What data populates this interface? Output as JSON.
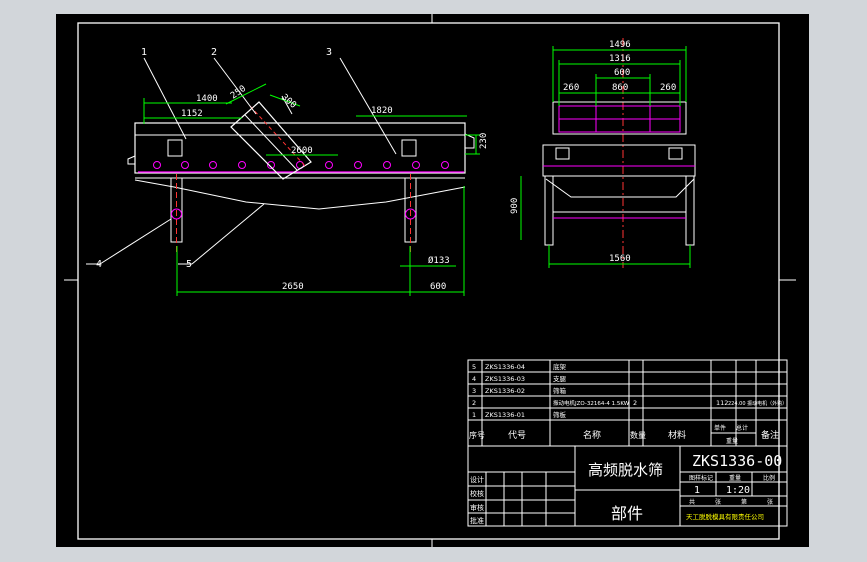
{
  "colors": {
    "background": "#000000",
    "frame": "#ffffff",
    "dimension": "#00ff00",
    "center_line": "#ff3333",
    "part_line": "#ff00ff",
    "text": "#ffffff",
    "title_text": "#ffff00",
    "window_bg": "#d2d6da"
  },
  "front_view": {
    "leaders": [
      "1",
      "2",
      "3",
      "4",
      "5"
    ],
    "dims": {
      "d1400": "1400",
      "d1152": "1152",
      "d250": "250",
      "d300": "300",
      "d1820": "1820",
      "d230": "230",
      "d2600": "2600",
      "d133": "Ø133",
      "d2650": "2650",
      "d600": "600"
    }
  },
  "side_view": {
    "dims": {
      "d1496": "1496",
      "d1316": "1316",
      "d600": "600",
      "d260a": "260",
      "d860": "860",
      "d260b": "260",
      "d900": "900",
      "d1560": "1560"
    }
  },
  "parts_table": {
    "rows": [
      {
        "no": "5",
        "code": "ZKS1336-04",
        "name": "底架",
        "qty": "",
        "material": "",
        "weight": "",
        "note": ""
      },
      {
        "no": "4",
        "code": "ZKS1336-03",
        "name": "支腿",
        "qty": "",
        "material": "",
        "weight": "",
        "note": ""
      },
      {
        "no": "3",
        "code": "ZKS1336-02",
        "name": "筛箱",
        "qty": "",
        "material": "",
        "weight": "",
        "note": ""
      },
      {
        "no": "2",
        "code": "",
        "name": "振动电机JZO-32164-4 1.5KW",
        "qty": "2",
        "material": "",
        "weight": "112",
        "note": "224.00 振动电机（外购）"
      },
      {
        "no": "1",
        "code": "ZKS1336-01",
        "name": "筛板",
        "qty": "",
        "material": "",
        "weight": "",
        "note": ""
      }
    ],
    "headers": {
      "no": "序号",
      "code": "代号",
      "name": "名称",
      "qty": "数量",
      "material": "材料",
      "single": "单件",
      "total": "总计",
      "weight": "重量",
      "note": "备注"
    }
  },
  "title_block": {
    "title": "高频脱水筛",
    "subtitle": "部件",
    "drawing_no": "ZKS1336-00",
    "col_labels": [
      "图样标记",
      "重量",
      "比例"
    ],
    "qty": "1",
    "scale": "1:20",
    "sheet_labels": [
      "共",
      "张",
      "第",
      "张"
    ],
    "company": "天工脱脱模具有限责任公司",
    "roles": [
      "设计",
      "校核",
      "审核",
      "批准"
    ]
  }
}
